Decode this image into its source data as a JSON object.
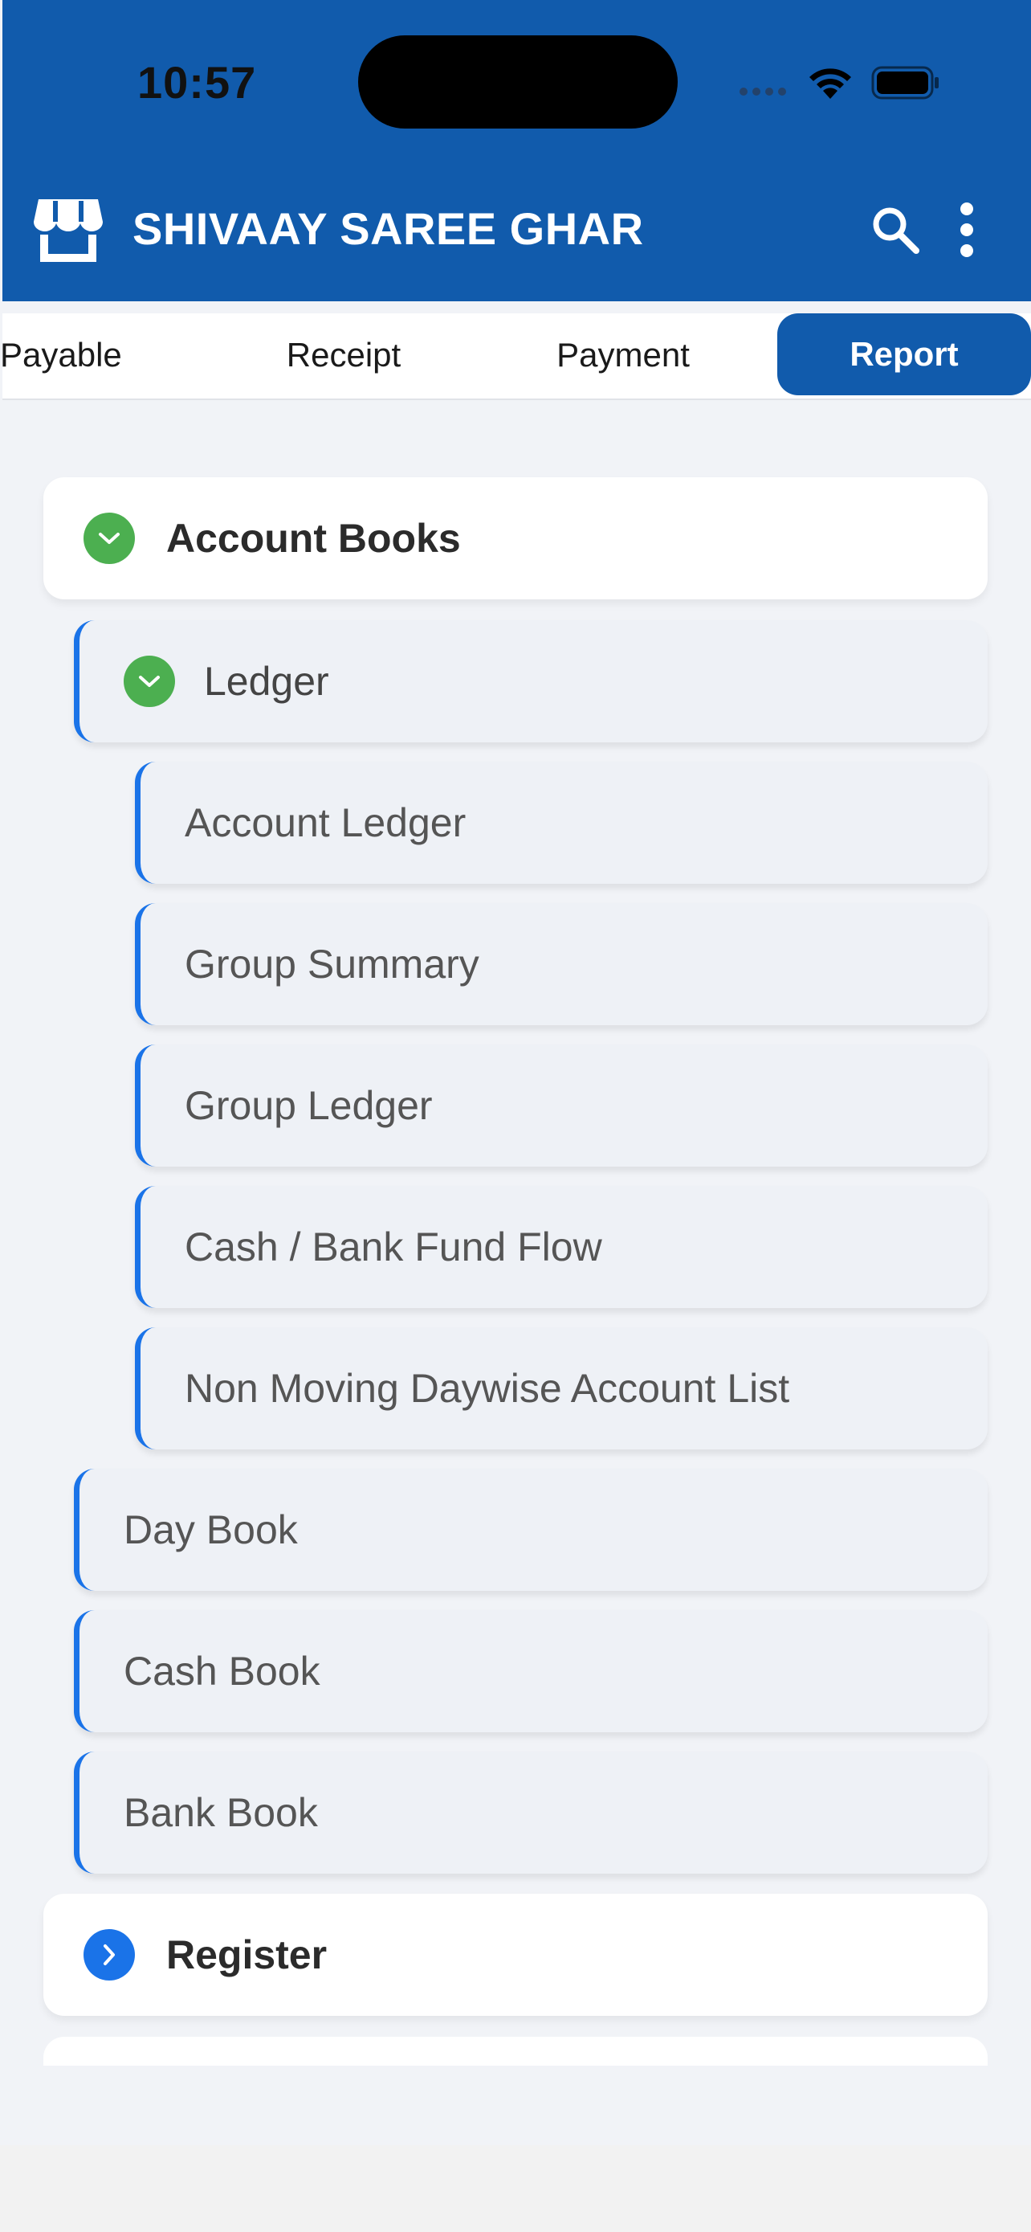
{
  "status_bar": {
    "time": "10:57"
  },
  "header": {
    "title": "SHIVAAY SAREE GHAR"
  },
  "tabs": [
    {
      "label": "Payable",
      "active": false
    },
    {
      "label": "Receipt",
      "active": false
    },
    {
      "label": "Payment",
      "active": false
    },
    {
      "label": "Report",
      "active": true
    }
  ],
  "menu": {
    "account_books": {
      "label": "Account Books",
      "expanded": true
    },
    "ledger": {
      "label": "Ledger",
      "expanded": true
    },
    "ledger_items": [
      "Account Ledger",
      "Group Summary",
      "Group Ledger",
      "Cash / Bank Fund Flow",
      "Non Moving Daywise Account List"
    ],
    "book_items": [
      "Day Book",
      "Cash Book",
      "Bank Book"
    ],
    "register": {
      "label": "Register",
      "expanded": false
    }
  },
  "colors": {
    "primary": "#115bac",
    "accent": "#1a73e8",
    "expanded_badge": "#4caf50",
    "collapsed_badge": "#1a73e8"
  }
}
